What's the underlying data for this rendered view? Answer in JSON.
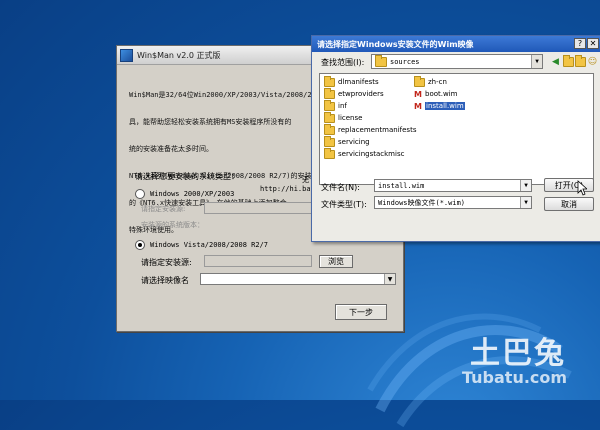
{
  "watermark": {
    "logo_text": "土巴兔",
    "site": "Tubatu.com"
  },
  "winman": {
    "title": "Win$Man v2.0 正式版",
    "description_lines": [
      "Win$Man是32/64位Win2000/XP/2003/Vista/2008/200",
      "具，能帮助您轻松安装系统拥有MS安装程序所没有的",
      "统的安装准备花太多时间。",
      "NT6.x系列(Windows Vista/2008/2008 R2/7)的安装是",
      "的《NT6.x快速安装工具》，在他的基础上添加整合",
      "特殊环境使用。"
    ],
    "author_line1": "无",
    "author_line2": "http://hi.bai",
    "select_type_label": "请选择您要安装的系统类型：",
    "option_legacy": "Windows 2000/XP/2003",
    "legacy_source_label": "请指定安装源:",
    "legacy_version_label": "安装源的系统版本：",
    "option_nt6": "Windows Vista/2008/2008 R2/7",
    "nt6_source_label": "请指定安装源:",
    "browse_label": "浏览",
    "image_label": "请选择映像名",
    "next_label": "下一步"
  },
  "dialog": {
    "title": "请选择指定Windows安装文件的Wim映像",
    "help_label": "?",
    "close_label": "✕",
    "lookin_label": "查找范围(I):",
    "lookin_value": "sources",
    "files": [
      {
        "name": "dlmanifests",
        "type": "folder"
      },
      {
        "name": "etwproviders",
        "type": "folder"
      },
      {
        "name": "inf",
        "type": "folder"
      },
      {
        "name": "license",
        "type": "folder"
      },
      {
        "name": "replacementmanifests",
        "type": "folder"
      },
      {
        "name": "servicing",
        "type": "folder"
      },
      {
        "name": "servicingstackmisc",
        "type": "folder"
      },
      {
        "name": "zh-cn",
        "type": "folder"
      },
      {
        "name": "boot.wim",
        "type": "wim"
      },
      {
        "name": "install.wim",
        "type": "wim",
        "selected": true
      }
    ],
    "filename_label": "文件名(N):",
    "filename_value": "install.wim",
    "filetype_label": "文件类型(T):",
    "filetype_value": "Windows映像文件(*.wim)",
    "open_label": "打开(O)",
    "cancel_label": "取消"
  }
}
